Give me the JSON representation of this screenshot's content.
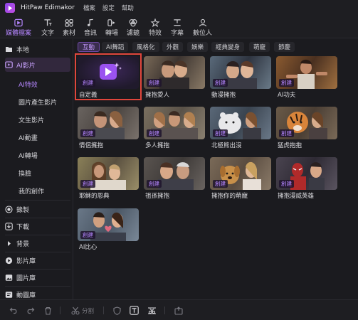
{
  "titlebar": {
    "app_title": "HitPaw Edimakor",
    "menus": [
      "檔案",
      "設定",
      "幫助"
    ]
  },
  "toolbar": {
    "tools": [
      {
        "label": "媒體檔案",
        "icon": "media-files-icon",
        "active": true
      },
      {
        "label": "文字",
        "icon": "text-icon"
      },
      {
        "label": "素材",
        "icon": "assets-icon"
      },
      {
        "label": "音訊",
        "icon": "music-note-icon"
      },
      {
        "label": "轉場",
        "icon": "transition-icon"
      },
      {
        "label": "濾鏡",
        "icon": "filter-icon"
      },
      {
        "label": "特效",
        "icon": "effects-icon"
      },
      {
        "label": "字幕",
        "icon": "subtitle-icon"
      },
      {
        "label": "數位人",
        "icon": "digital-human-icon"
      }
    ]
  },
  "sidebar": {
    "local": "本地",
    "ai_video": "AI影片",
    "sub_items": [
      "AI特效",
      "圖片產生影片",
      "文生影片",
      "AI動畫",
      "AI轉場",
      "換臉",
      "我的創作"
    ],
    "record": "錄製",
    "download": "下載",
    "background": "背景",
    "video_library": "影片庫",
    "image_library": "圖片庫",
    "animation_library": "動圖庫"
  },
  "tabs": [
    "互動",
    "AI舞蹈",
    "風格化",
    "外觀",
    "娛樂",
    "經典變身",
    "萌寵",
    "節慶"
  ],
  "cards": [
    {
      "caption": "自定義",
      "badge": "創建"
    },
    {
      "caption": "擁抱愛人",
      "badge": "創建"
    },
    {
      "caption": "動漫擁抱",
      "badge": "創建"
    },
    {
      "caption": "AI功夫",
      "badge": "創建"
    },
    {
      "caption": "情侶擁抱",
      "badge": "創建"
    },
    {
      "caption": "多人擁抱",
      "badge": "創建"
    },
    {
      "caption": "北極熊出沒",
      "badge": "創建"
    },
    {
      "caption": "猛虎抱抱",
      "badge": "創建"
    },
    {
      "caption": "耶穌的恩典",
      "badge": "創建"
    },
    {
      "caption": "祖孫擁抱",
      "badge": "創建"
    },
    {
      "caption": "擁抱你的萌寵",
      "badge": "創建"
    },
    {
      "caption": "擁抱漫威英雄",
      "badge": "創建"
    },
    {
      "caption": "AI比心",
      "badge": "創建"
    }
  ],
  "bottombar": {
    "split_label": "分割"
  },
  "colors": {
    "accent": "#b586ff",
    "highlight_border": "#e0463c",
    "background": "#1b1b1f"
  }
}
